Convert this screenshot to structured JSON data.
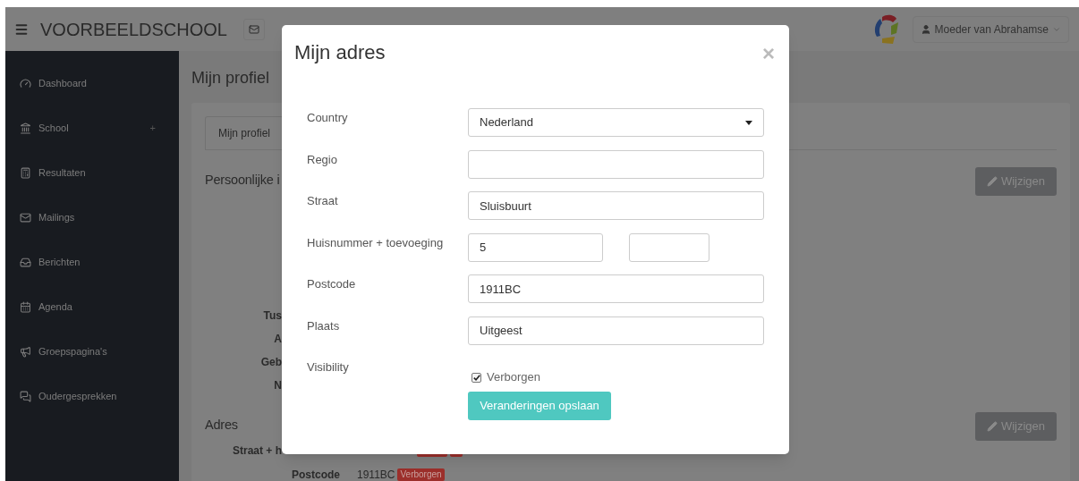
{
  "navbar": {
    "brand": "VOORBEELDSCHOOL",
    "user": "Moeder van Abrahamse"
  },
  "sidebar": {
    "items": [
      {
        "label": "Dashboard"
      },
      {
        "label": "School",
        "expander": "+"
      },
      {
        "label": "Resultaten"
      },
      {
        "label": "Mailings"
      },
      {
        "label": "Berichten"
      },
      {
        "label": "Agenda"
      },
      {
        "label": "Groepspagina's"
      },
      {
        "label": "Oudergesprekken"
      }
    ]
  },
  "page": {
    "title": "Mijn profiel",
    "tabs": [
      {
        "label": "Mijn profiel",
        "selected": true
      }
    ],
    "sections": [
      {
        "heading": "Persoonlijke i",
        "button": "Wijzigen",
        "rows": [
          {
            "label": "Tus"
          },
          {
            "label": "A"
          },
          {
            "label": "Geb"
          },
          {
            "label": "N"
          }
        ]
      },
      {
        "heading": "Adres",
        "button": "Wijzigen",
        "rows": [
          {
            "label": "Straat + h",
            "covered_badges": true
          },
          {
            "label": "Postcode",
            "value": "1911BC",
            "badge": "Verborgen"
          }
        ]
      }
    ]
  },
  "modal": {
    "title": "Mijn adres",
    "close": "×",
    "fields": [
      {
        "kind": "select",
        "label": "Country",
        "value": "Nederland"
      },
      {
        "kind": "text",
        "label": "Regio"
      },
      {
        "kind": "text",
        "label": "Straat",
        "value": "Sluisbuurt"
      },
      {
        "kind": "pair",
        "label": "Huisnummer + toevoeging",
        "value": "5"
      },
      {
        "kind": "text",
        "label": "Postcode",
        "value": "1911BC"
      },
      {
        "kind": "text",
        "label": "Plaats",
        "value": "Uitgeest"
      },
      {
        "kind": "checkbox",
        "label": "Visibility",
        "option": "Verborgen",
        "checked": true
      }
    ],
    "submit": "Veranderingen opslaan"
  }
}
